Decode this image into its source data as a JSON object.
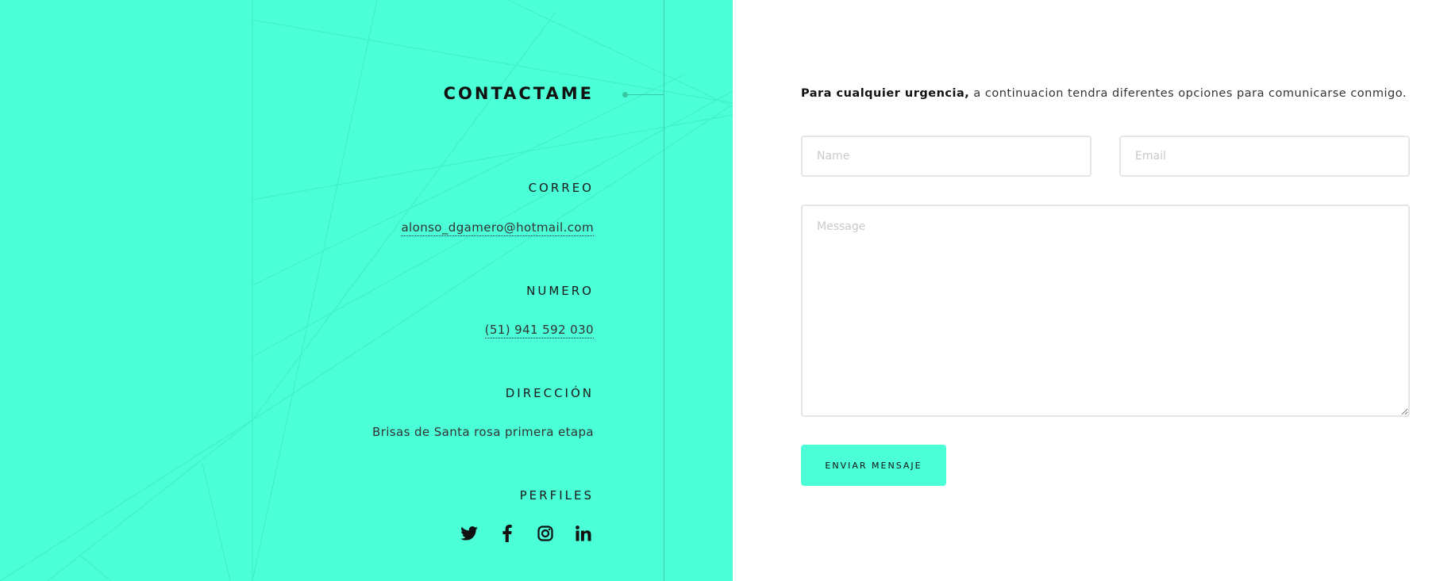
{
  "contact": {
    "title": "CONTACTAME",
    "email_label": "CORREO",
    "email_value": "alonso_dgamero@hotmail.com",
    "phone_label": "NUMERO",
    "phone_value": "(51) 941 592 030",
    "address_label": "DIRECCIÓN",
    "address_value": "Brisas de Santa rosa primera etapa",
    "profiles_label": "PERFILES",
    "profiles": [
      {
        "icon": "twitter-icon"
      },
      {
        "icon": "facebook-icon"
      },
      {
        "icon": "instagram-icon"
      },
      {
        "icon": "linkedin-icon"
      }
    ]
  },
  "form": {
    "intro_bold": "Para cualquier urgencia,",
    "intro_rest": " a continuacion tendra diferentes opciones para comunicarse conmigo.",
    "name_placeholder": "Name",
    "name_value": "",
    "email_placeholder": "Email",
    "email_value": "",
    "message_placeholder": "Message",
    "message_value": "",
    "submit_label": "ENVIAR MENSAJE"
  },
  "colors": {
    "accent": "#4bffd6",
    "accent_line": "#3ccfa9",
    "background": "#ffffff",
    "text": "#111111",
    "field_border": "#e6e6e6"
  }
}
